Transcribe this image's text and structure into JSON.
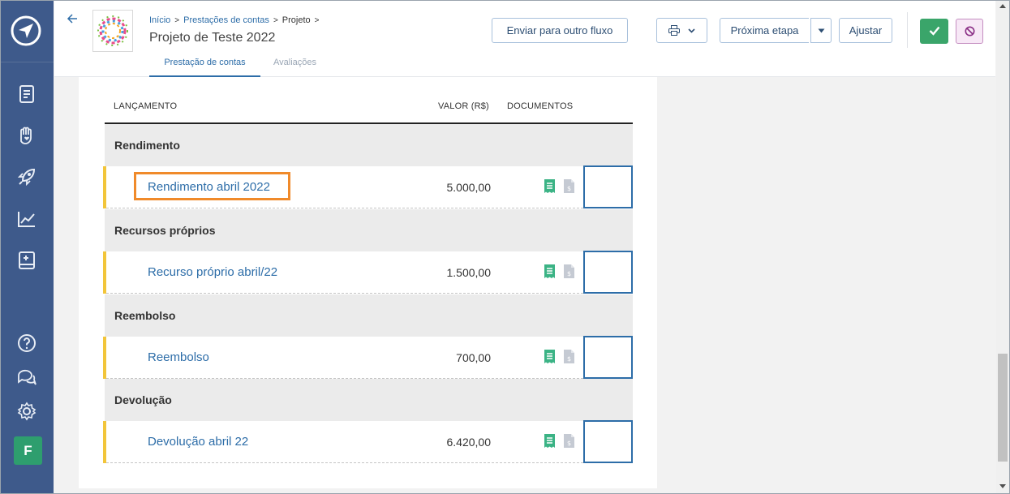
{
  "header": {
    "breadcrumb": [
      "Início",
      "Prestações de contas",
      "Projeto"
    ],
    "title": "Projeto de Teste 2022",
    "tabs": [
      "Prestação de contas",
      "Avaliações"
    ],
    "buttons": {
      "send_flow": "Enviar para outro fluxo",
      "next_step": "Próxima etapa",
      "adjust": "Ajustar"
    },
    "icons": {
      "back": "back-arrow-icon",
      "print": "printer-icon",
      "ok": "check-icon",
      "cancel": "ban-icon"
    }
  },
  "sidebar": {
    "icons": [
      "logo-send-icon",
      "document-icon",
      "hand-heart-icon",
      "rocket-icon",
      "chart-line-icon",
      "book-icon",
      "help-icon",
      "chat-icon",
      "gear-icon"
    ],
    "avatar_letter": "F"
  },
  "table": {
    "columns": [
      "LANÇAMENTO",
      "VALOR (R$)",
      "DOCUMENTOS"
    ],
    "groups": [
      {
        "label": "Rendimento",
        "item": {
          "label": "Rendimento abril 2022",
          "value": "5.000,00"
        }
      },
      {
        "label": "Recursos próprios",
        "item": {
          "label": "Recurso próprio abril/22",
          "value": "1.500,00"
        }
      },
      {
        "label": "Reembolso",
        "item": {
          "label": "Reembolso",
          "value": "700,00"
        }
      },
      {
        "label": "Devolução",
        "item": {
          "label": "Devolução abril 22",
          "value": "6.420,00"
        }
      }
    ]
  },
  "colors": {
    "sidebar": "#3e5a8b",
    "link": "#2d6da8",
    "accent_bar": "#f2c53a",
    "highlight": "#f08a2a",
    "ok_button": "#3aa56a",
    "doc_icon": "#3bb385"
  }
}
